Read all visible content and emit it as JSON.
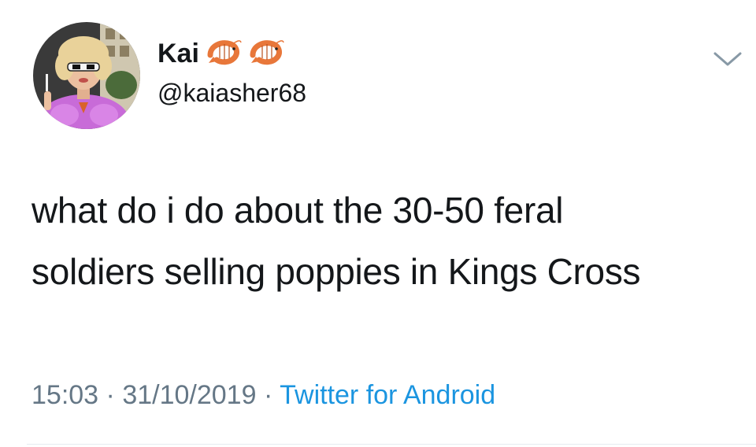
{
  "user": {
    "display_name": "Kai",
    "handle": "@kaiasher68",
    "name_emoji": [
      "shrimp-icon",
      "shrimp-icon"
    ]
  },
  "tweet": {
    "lines": [
      "what do i do about the 30-50 feral",
      "soldiers selling poppies in Kings Cross"
    ]
  },
  "meta": {
    "time": "15:03",
    "separator": "·",
    "date": "31/10/2019",
    "source": "Twitter for Android"
  },
  "colors": {
    "text": "#14171a",
    "secondary": "#657786",
    "link": "#1b95e0",
    "avatar_sweater": "#c86bd8"
  }
}
